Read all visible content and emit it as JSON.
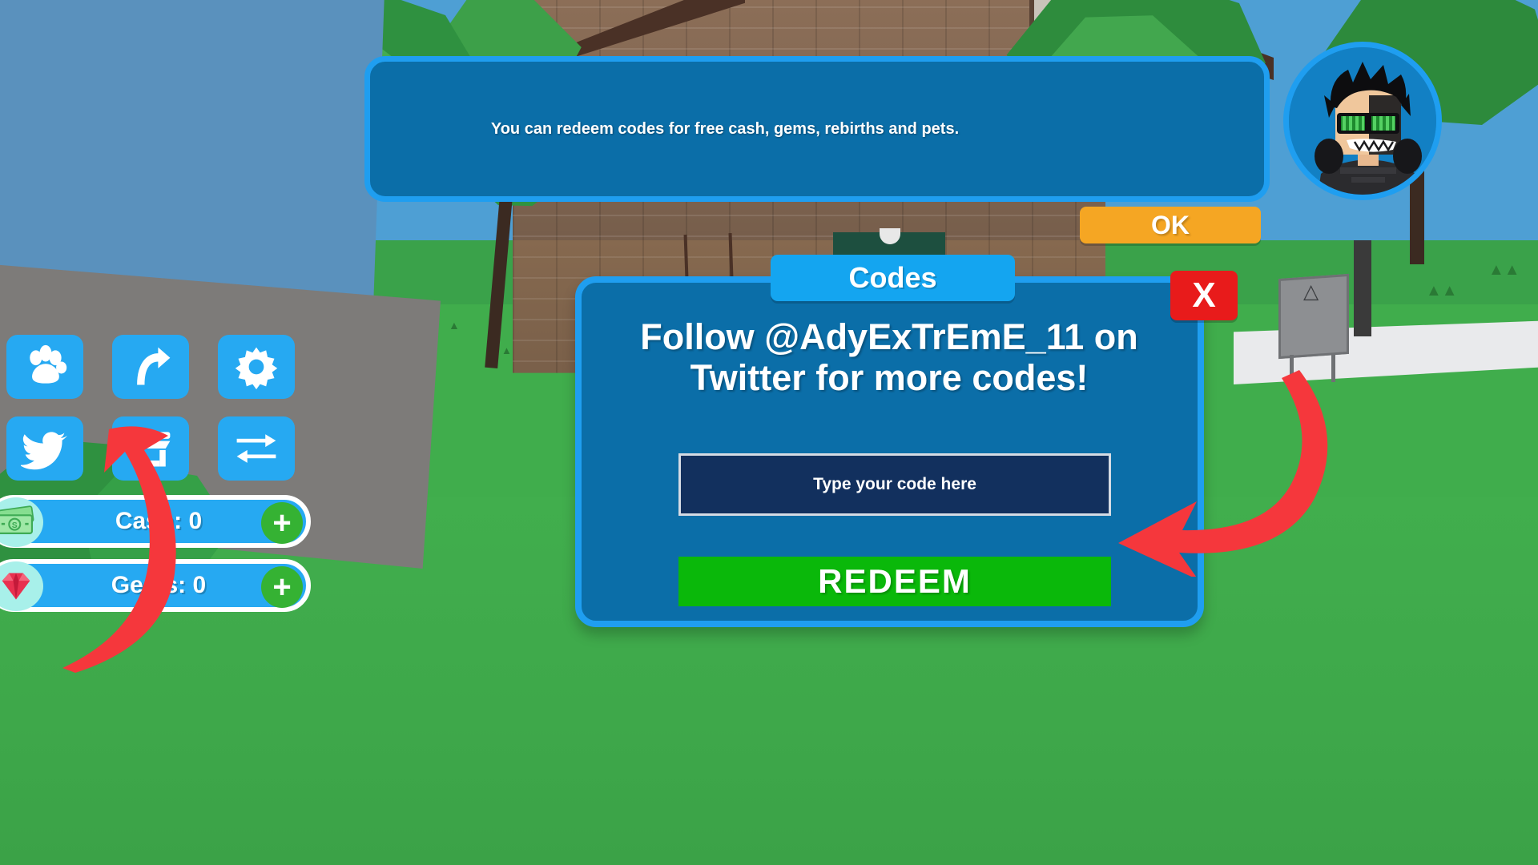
{
  "scene": {
    "description": "Roblox low-poly outdoor game world with brick house, trees and grass",
    "colors": {
      "sky": "#4e9fd4",
      "grass": "#40ad4c",
      "brick": "#7e6450",
      "path": "#e9eaec"
    }
  },
  "notification": {
    "text": "You can redeem codes for free cash, gems, rebirths and pets.",
    "ok_label": "OK",
    "panel_color": "#0b6ea8",
    "border_color": "#1f9ef0",
    "ok_color": "#f5a623"
  },
  "avatar": {
    "name": "player-avatar",
    "description": "Roblox character with black spiky hair, green visor glasses and toothy grin"
  },
  "codes_dialog": {
    "title": "Codes",
    "title_color": "#14a5f0",
    "headline": "Follow @AdyExTrEmE_11 on Twitter for more codes!",
    "input_placeholder": "Type your code here",
    "input_value": "",
    "input_bg": "#12305e",
    "redeem_label": "REDEEM",
    "redeem_color": "#0ab80a",
    "close_label": "X",
    "close_color": "#e81b1b",
    "panel_color": "#0b6ea8",
    "border_color": "#1f9ef0"
  },
  "hud": {
    "button_color": "#26a9f2",
    "buttons": [
      {
        "icon": "paw-icon",
        "name": "pets-button"
      },
      {
        "icon": "rebirth-arrow-icon",
        "name": "rebirth-button"
      },
      {
        "icon": "gear-icon",
        "name": "settings-button"
      },
      {
        "icon": "twitter-bird-icon",
        "name": "twitter-button"
      },
      {
        "icon": "shop-icon",
        "name": "shop-codes-button"
      },
      {
        "icon": "trade-arrows-icon",
        "name": "trade-button"
      }
    ]
  },
  "currency": {
    "bar_color": "#26a9f2",
    "plus_color": "#35b233",
    "items": [
      {
        "icon": "cash-bill-icon",
        "label": "Cash: 0",
        "value": 0,
        "plus": "+"
      },
      {
        "icon": "gem-diamond-icon",
        "label": "Gems: 0",
        "value": 0,
        "plus": "+"
      }
    ]
  },
  "annotations": {
    "color": "#f5373c",
    "arrows": [
      {
        "name": "arrow-to-shop-button",
        "direction": "up-left"
      },
      {
        "name": "arrow-to-code-input",
        "direction": "left"
      }
    ]
  }
}
